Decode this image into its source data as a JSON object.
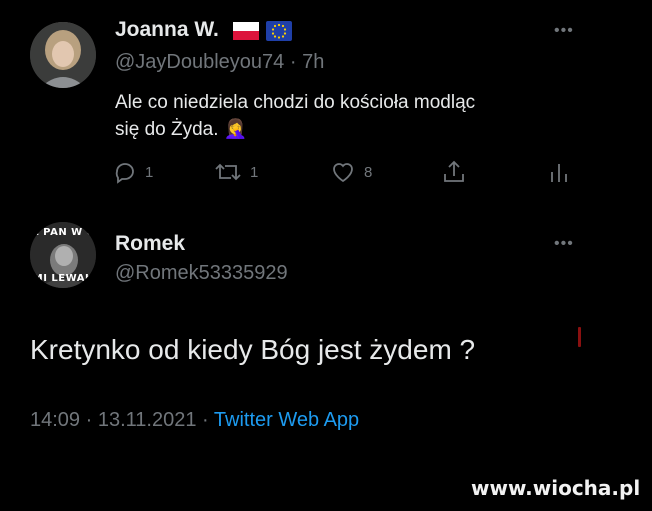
{
  "reply": {
    "author_name": "Joanna W.",
    "author_handle": "@JayDoubleyou74",
    "separator": "·",
    "time_ago": "7h",
    "text_line1": "Ale co niedziela chodzi do kościoła modląc",
    "text_line2": "się do Żyda.",
    "emoji": "🤦‍♀️",
    "flags": [
      "pl-flag",
      "eu-flag"
    ],
    "actions": {
      "reply_count": "1",
      "retweet_count": "1",
      "like_count": "8"
    },
    "more": "•••"
  },
  "tweet": {
    "author_name": "Romek",
    "author_handle": "@Romek53335929",
    "avatar_caption_top": "Z PAN W C",
    "avatar_caption_bottom": "MI LEWAK",
    "text": "Kretynko od kiedy Bóg jest żydem ?",
    "time": "14:09",
    "dot": "·",
    "date": "13.11.2021",
    "source": "Twitter Web App",
    "more": "•••"
  },
  "watermark": "www.wiocha.pl",
  "colors": {
    "background": "#000000",
    "text": "#e7e9ea",
    "muted": "#71767b",
    "accent": "#1d9bf0"
  }
}
